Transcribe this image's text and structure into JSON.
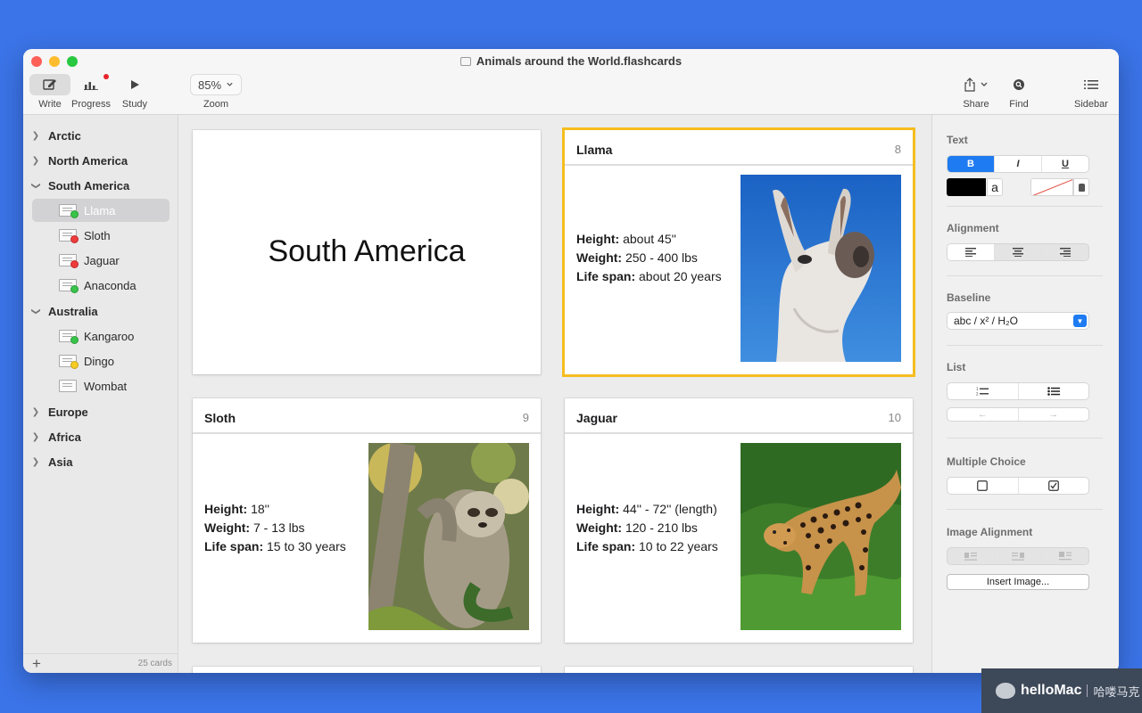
{
  "window": {
    "title": "Animals around the World.flashcards"
  },
  "toolbar": {
    "write_label": "Write",
    "progress_label": "Progress",
    "study_label": "Study",
    "zoom_value": "85%",
    "zoom_label": "Zoom",
    "share_label": "Share",
    "find_label": "Find",
    "sidebar_label": "Sidebar"
  },
  "sidebar": {
    "groups": [
      {
        "label": "Arctic",
        "expanded": false
      },
      {
        "label": "North America",
        "expanded": false
      },
      {
        "label": "South America",
        "expanded": true
      },
      {
        "label": "Australia",
        "expanded": true
      },
      {
        "label": "Europe",
        "expanded": false
      },
      {
        "label": "Africa",
        "expanded": false
      },
      {
        "label": "Asia",
        "expanded": false
      }
    ],
    "south_america_items": [
      {
        "label": "Llama",
        "status": "green",
        "selected": true
      },
      {
        "label": "Sloth",
        "status": "red"
      },
      {
        "label": "Jaguar",
        "status": "red"
      },
      {
        "label": "Anaconda",
        "status": "green"
      }
    ],
    "australia_items": [
      {
        "label": "Kangaroo",
        "status": "green"
      },
      {
        "label": "Dingo",
        "status": "yellow"
      },
      {
        "label": "Wombat",
        "status": "none"
      }
    ],
    "card_count": "25 cards"
  },
  "cards": {
    "section_title": "South America",
    "llama": {
      "title": "Llama",
      "number": "8",
      "height_label": "Height:",
      "height_value": " about 45''",
      "weight_label": "Weight:",
      "weight_value": " 250 - 400 lbs",
      "lifespan_label": "Life span:",
      "lifespan_value": " about 20 years"
    },
    "sloth": {
      "title": "Sloth",
      "number": "9",
      "height_label": "Height:",
      "height_value": " 18''",
      "weight_label": "Weight:",
      "weight_value": " 7 - 13 lbs",
      "lifespan_label": "Life span:",
      "lifespan_value": " 15 to 30 years"
    },
    "jaguar": {
      "title": "Jaguar",
      "number": "10",
      "height_label": "Height:",
      "height_value": " 44'' - 72'' (length)",
      "weight_label": "Weight:",
      "weight_value": " 120 - 210 lbs",
      "lifespan_label": "Life span:",
      "lifespan_value": " 10 to 22 years"
    }
  },
  "inspector": {
    "text_label": "Text",
    "bold": "B",
    "italic": "I",
    "underline": "U",
    "text_color_sample": "a",
    "alignment_label": "Alignment",
    "baseline_label": "Baseline",
    "baseline_value": "abc  /  x²  /  H₂O",
    "list_label": "List",
    "list_prev": "←",
    "list_next": "→",
    "multiple_choice_label": "Multiple Choice",
    "image_alignment_label": "Image Alignment",
    "insert_image": "Insert Image..."
  },
  "colors": {
    "accent": "#1f7bf1",
    "selection_outline": "#f5bd1f",
    "status_green": "#39c34a",
    "status_red": "#ef3b3b",
    "status_yellow": "#f7cc22",
    "desktop": "#3b74e8"
  },
  "watermark": {
    "brand": "helloMac",
    "sub": "哈喽马克"
  }
}
